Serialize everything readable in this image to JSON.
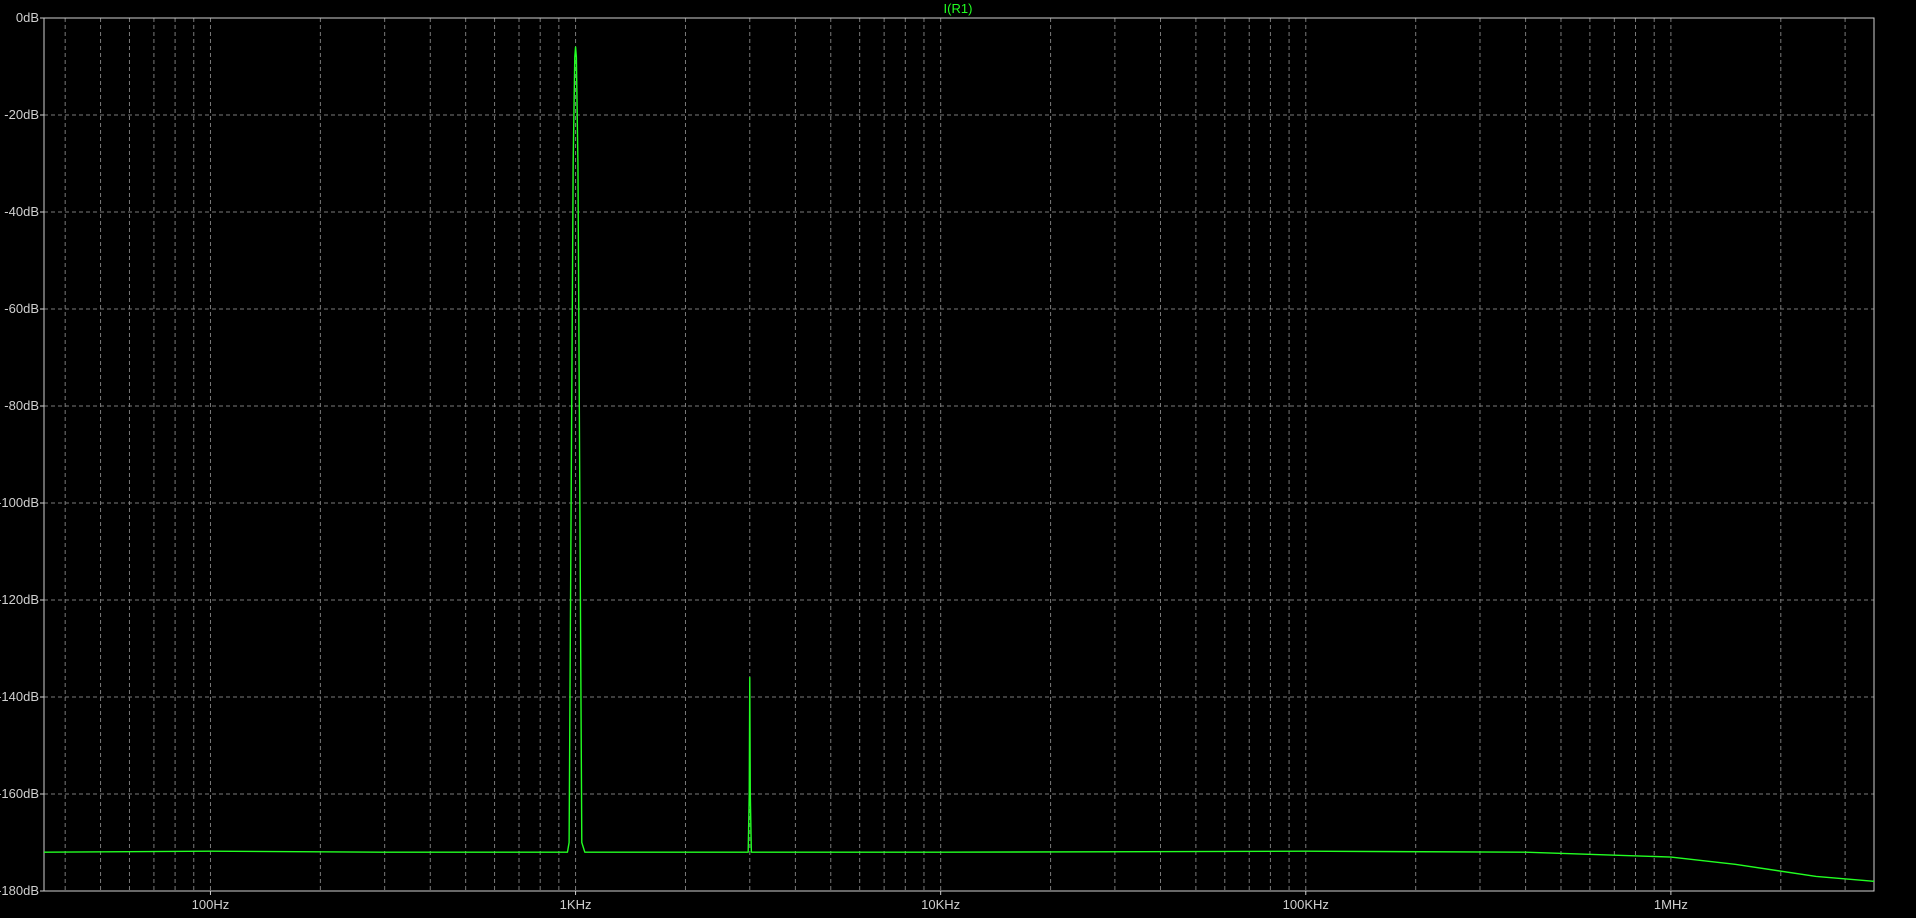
{
  "chart_data": {
    "type": "line",
    "title": "I(R1)",
    "x_scale": "log",
    "xlim_hz": [
      35,
      3600000
    ],
    "ylim_db": [
      -180,
      0
    ],
    "y_ticks": [
      {
        "value": 0,
        "label": "0dB"
      },
      {
        "value": -20,
        "label": "-20dB"
      },
      {
        "value": -40,
        "label": "-40dB"
      },
      {
        "value": -60,
        "label": "-60dB"
      },
      {
        "value": -80,
        "label": "-80dB"
      },
      {
        "value": -100,
        "label": "-100dB"
      },
      {
        "value": -120,
        "label": "-120dB"
      },
      {
        "value": -140,
        "label": "-140dB"
      },
      {
        "value": -160,
        "label": "-160dB"
      },
      {
        "value": -180,
        "label": "-180dB"
      }
    ],
    "x_ticks": [
      {
        "value": 100,
        "label": "100Hz"
      },
      {
        "value": 1000,
        "label": "1KHz"
      },
      {
        "value": 10000,
        "label": "10KHz"
      },
      {
        "value": 100000,
        "label": "100KHz"
      },
      {
        "value": 1000000,
        "label": "1MHz"
      }
    ],
    "grid": true,
    "colors": {
      "background": "#000000",
      "trace": "#22ff22",
      "grid": "#7a7a7a",
      "frame": "#cfcfcf",
      "title": "#22ff22"
    },
    "series": [
      {
        "name": "I(R1)",
        "x_hz": [
          35,
          100,
          300,
          700,
          950,
          960,
          985,
          995,
          1000,
          1005,
          1015,
          1040,
          1060,
          2000,
          2970,
          2990,
          3000,
          3010,
          3030,
          10000,
          100000,
          400000,
          1000000,
          1500000,
          2500000,
          3600000
        ],
        "y_db": [
          -172,
          -171.8,
          -172,
          -172,
          -172,
          -170,
          -30,
          -8,
          -6,
          -8,
          -30,
          -170,
          -172,
          -172,
          -172,
          -160,
          -136,
          -160,
          -172,
          -172,
          -171.8,
          -172,
          -173,
          -174.5,
          -177,
          -178
        ]
      }
    ]
  }
}
